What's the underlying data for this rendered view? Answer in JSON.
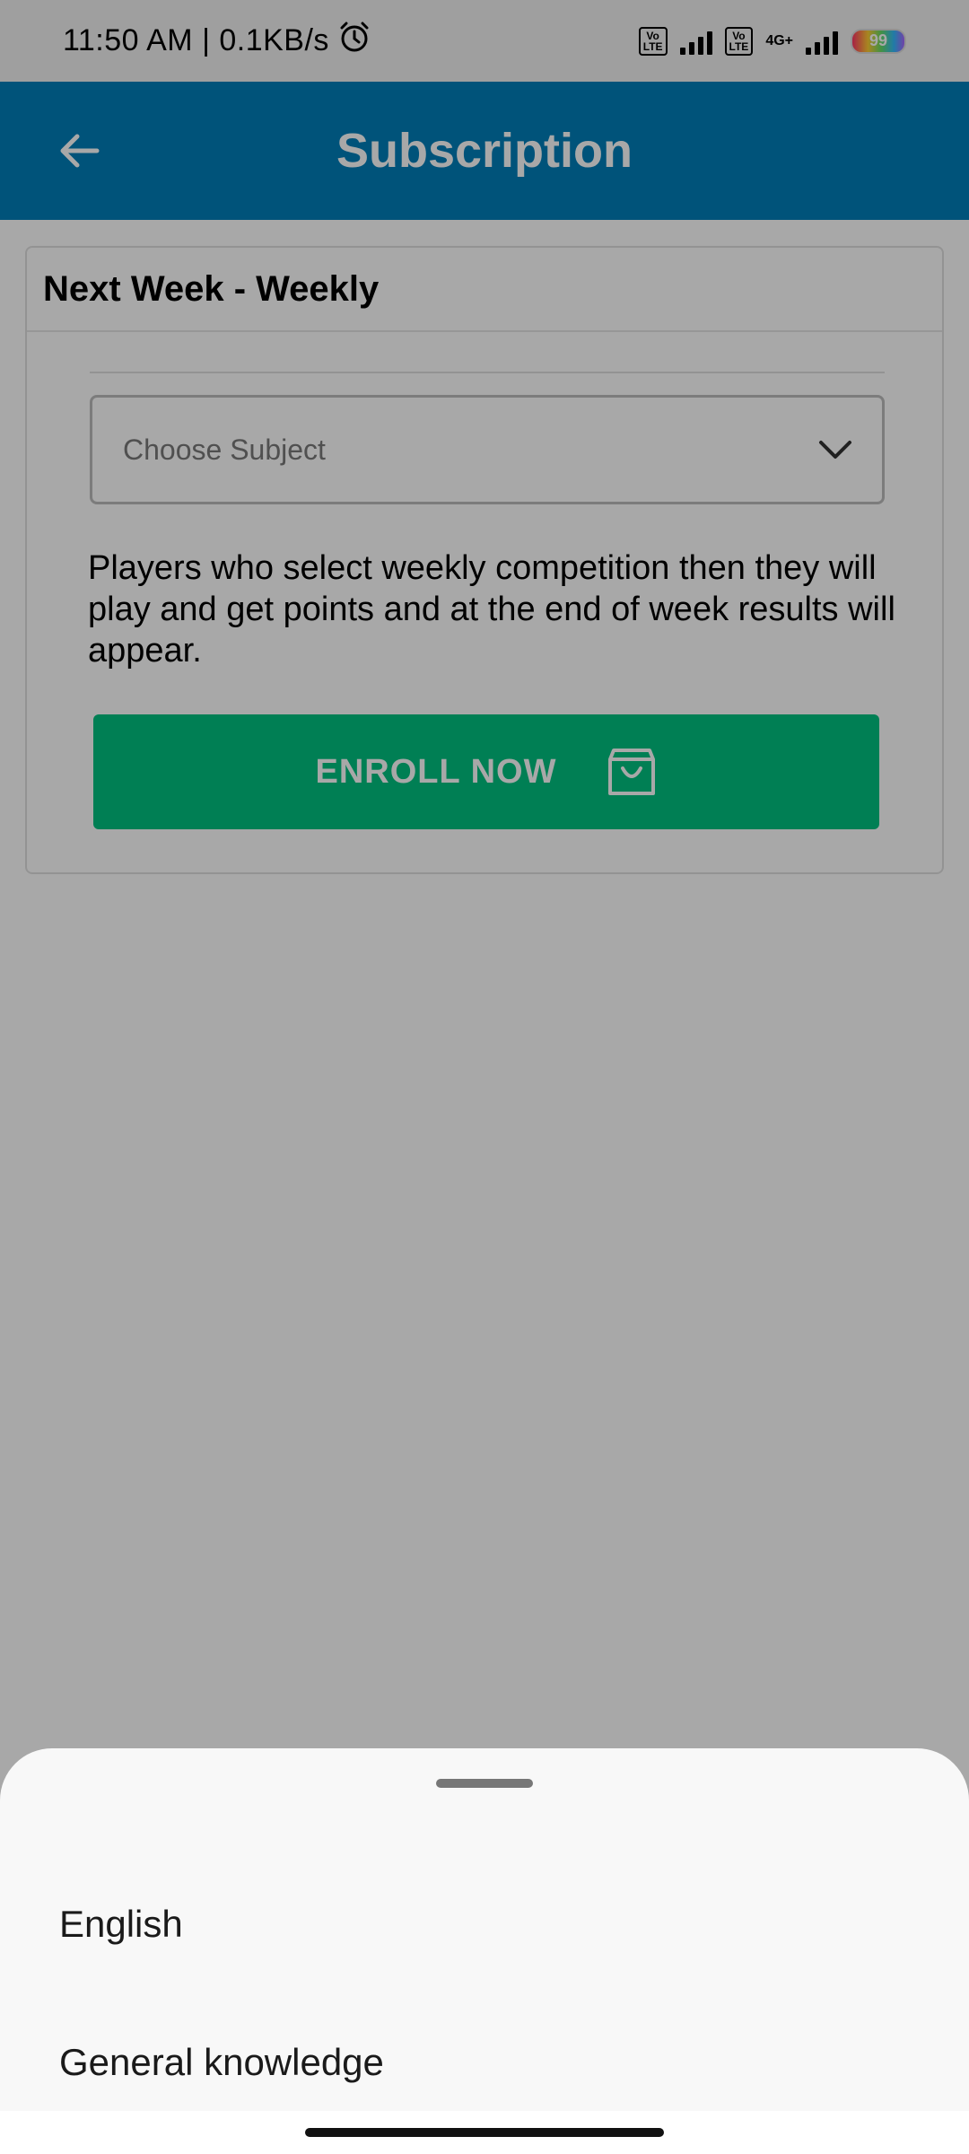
{
  "status_bar": {
    "time_speed": "11:50 AM | 0.1KB/s",
    "sim1_tag": "Vo\nLTE",
    "sim2_tag": "Vo\nLTE",
    "network": "4G+",
    "battery": "99"
  },
  "app_bar": {
    "title": "Subscription"
  },
  "card": {
    "title": "Next Week - Weekly",
    "subject_placeholder": "Choose Subject",
    "description": "Players who select weekly competition then they will play and get points and at the end of week results will appear.",
    "enroll_label": "ENROLL NOW"
  },
  "sheet": {
    "options": [
      {
        "label": "English"
      },
      {
        "label": "General knowledge"
      }
    ]
  },
  "colors": {
    "app_bar": "#007fba",
    "enroll_button": "#00c180",
    "scrim": "rgba(0,0,0,0.34)"
  }
}
